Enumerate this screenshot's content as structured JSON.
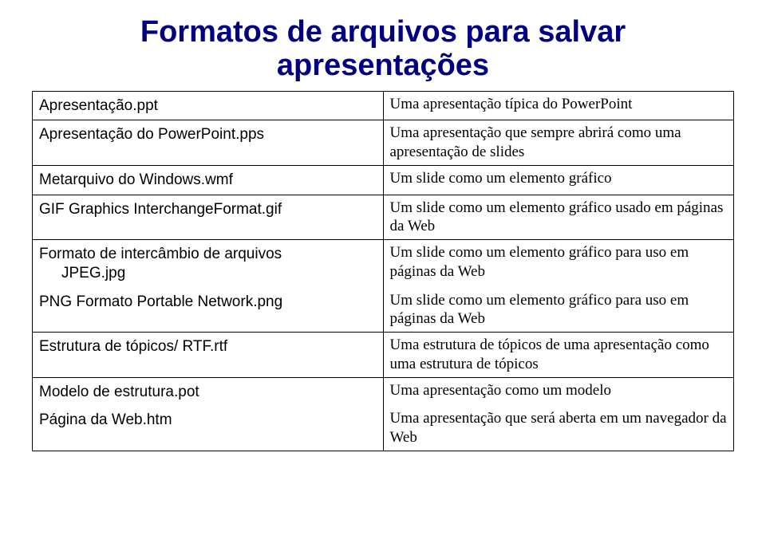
{
  "title": "Formatos de arquivos para salvar apresentações",
  "rows": [
    {
      "left": "Apresentação.ppt",
      "right": "Uma apresentação típica do PowerPoint"
    },
    {
      "left": "Apresentação do PowerPoint.pps",
      "right": "Uma apresentação que sempre abrirá como uma apresentação de slides"
    },
    {
      "left": "Metarquivo do Windows.wmf",
      "right": "Um slide como um elemento gráfico"
    },
    {
      "left": "GIF Graphics InterchangeFormat.gif",
      "right": "Um slide como um elemento gráfico usado em páginas da Web"
    },
    {
      "left_a": "Formato de intercâmbio de arquivos",
      "left_b": "JPEG.jpg",
      "right": "Um slide como um elemento gráfico para uso em páginas da Web"
    },
    {
      "left": "PNG Formato Portable Network.png",
      "right": "Um slide como um elemento gráfico para uso em páginas da Web"
    },
    {
      "left": "Estrutura de tópicos/ RTF.rtf",
      "right": "Uma estrutura de tópicos de uma apresentação como uma estrutura de tópicos"
    },
    {
      "left": "Modelo de estrutura.pot",
      "right": "Uma apresentação como um modelo"
    },
    {
      "left": "Página da Web.htm",
      "right": "Uma apresentação que será aberta em um navegador da Web"
    }
  ]
}
